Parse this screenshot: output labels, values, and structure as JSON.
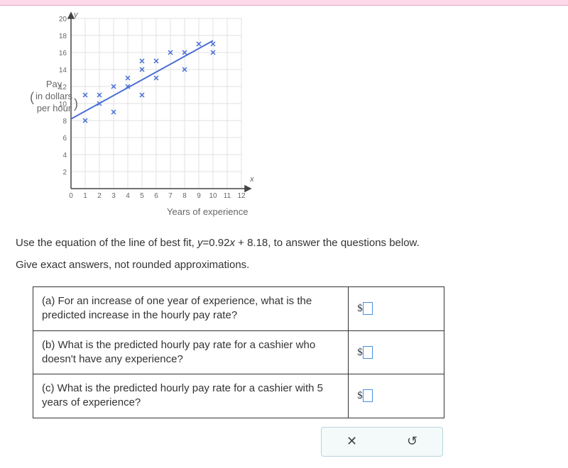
{
  "chart_data": {
    "type": "scatter",
    "title": "",
    "xlabel": "Years of experience",
    "ylabel_lines": [
      "Pay",
      "in dollars",
      "per hour"
    ],
    "xlim": [
      0,
      12
    ],
    "ylim": [
      0,
      20
    ],
    "xticks": [
      0,
      1,
      2,
      3,
      4,
      5,
      6,
      7,
      8,
      9,
      10,
      11,
      12
    ],
    "yticks": [
      2,
      4,
      6,
      8,
      10,
      12,
      14,
      16,
      18,
      20
    ],
    "axis_y_label": "y",
    "axis_x_label": "x",
    "points": [
      {
        "x": 1,
        "y": 8
      },
      {
        "x": 1,
        "y": 11
      },
      {
        "x": 2,
        "y": 10
      },
      {
        "x": 2,
        "y": 11
      },
      {
        "x": 3,
        "y": 9
      },
      {
        "x": 3,
        "y": 12
      },
      {
        "x": 4,
        "y": 12
      },
      {
        "x": 4,
        "y": 13
      },
      {
        "x": 5,
        "y": 11
      },
      {
        "x": 5,
        "y": 14
      },
      {
        "x": 5,
        "y": 15
      },
      {
        "x": 6,
        "y": 13
      },
      {
        "x": 6,
        "y": 15
      },
      {
        "x": 7,
        "y": 16
      },
      {
        "x": 8,
        "y": 14
      },
      {
        "x": 8,
        "y": 16
      },
      {
        "x": 9,
        "y": 17
      },
      {
        "x": 10,
        "y": 17
      },
      {
        "x": 10,
        "y": 16
      }
    ],
    "fit_line": {
      "slope": 0.92,
      "intercept": 8.18,
      "x1": 0,
      "x2": 10
    }
  },
  "equation_prefix": "Use the equation of the line of best fit, ",
  "equation_lhs": "y",
  "equation_eq": "=",
  "equation_rhs": "0.92x + 8.18",
  "equation_suffix": ", to answer the questions below.",
  "instruction": "Give exact answers, not rounded approximations.",
  "questions": {
    "a": "(a) For an increase of one year of experience, what is the predicted increase in the hourly pay rate?",
    "b": "(b) What is the predicted hourly pay rate for a cashier who doesn't have any experience?",
    "c": "(c) What is the predicted hourly pay rate for a cashier with 5 years of experience?"
  },
  "currency": "$",
  "toolbar": {
    "clear_icon": "✕",
    "reset_icon": "↺"
  }
}
